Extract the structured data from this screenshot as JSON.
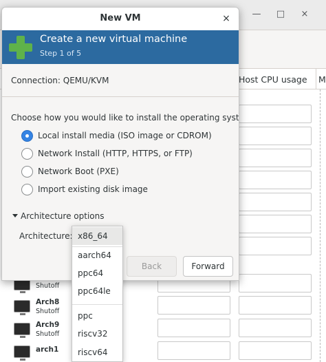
{
  "background_window": {
    "controls": {
      "minimize": "—",
      "maximize": "□",
      "close": "×"
    },
    "columns": [
      {
        "label": "Host CPU usage"
      },
      {
        "label": "M"
      }
    ],
    "vms": [
      {
        "name": "",
        "state": "Shutoff"
      },
      {
        "name": "Arch8",
        "state": "Shutoff"
      },
      {
        "name": "Arch9",
        "state": "Shutoff"
      },
      {
        "name": "arch1",
        "state": ""
      }
    ]
  },
  "dialog": {
    "title": "New VM",
    "close_glyph": "×",
    "banner": {
      "title": "Create a new virtual machine",
      "step": "Step 1 of 5",
      "icon": "plus-icon"
    },
    "connection": {
      "label": "Connection:",
      "value": "QEMU/KVM"
    },
    "install_prompt": "Choose how you would like to install the operating system",
    "install_options": [
      {
        "label": "Local install media (ISO image or CDROM)",
        "selected": true
      },
      {
        "label": "Network Install (HTTP, HTTPS, or FTP)",
        "selected": false
      },
      {
        "label": "Network Boot (PXE)",
        "selected": false
      },
      {
        "label": "Import existing disk image",
        "selected": false
      }
    ],
    "architecture": {
      "expander_label": "Architecture options",
      "label": "Architecture:",
      "options": [
        "x86_64",
        "aarch64",
        "ppc64",
        "ppc64le",
        "ppc",
        "riscv32",
        "riscv64"
      ],
      "selected": "x86_64"
    },
    "buttons": {
      "back": "Back",
      "forward": "Forward"
    }
  },
  "colors": {
    "banner_background": "#2c6aa0",
    "banner_icon": "#5fb24a",
    "radio_selected": "#3584e4"
  }
}
